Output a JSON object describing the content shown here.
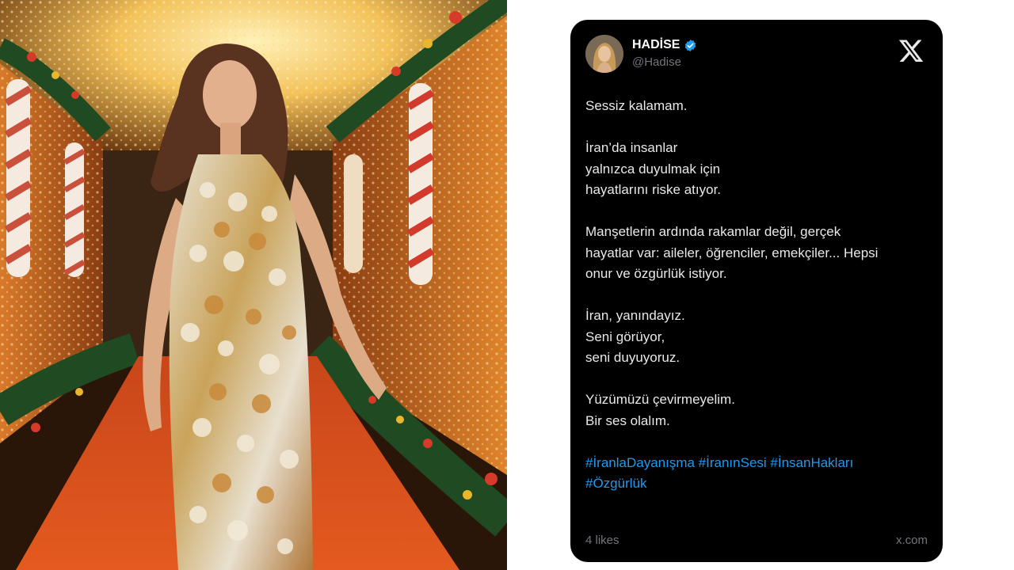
{
  "tweet": {
    "name": "HADİSE",
    "handle": "@Hadise",
    "paragraphs": [
      "Sessiz kalamam.",
      "İran’da insanlar\nyalnızca duyulmak için\nhayatlarını riske atıyor.",
      "Manşetlerin ardında rakamlar değil, gerçek\nhayatlar var: aileler, öğrenciler, emekçiler... Hepsi\nonur ve özgürlük istiyor.",
      "İran, yanındayız.\nSeni görüyor,\nseni duyuyoruz.",
      "Yüzümüzü çevirmeyelim.\nBir ses olalım."
    ],
    "hashtags": "#İranlaDayanışma #İranınSesi #İnsanHakları\n#Özgürlük",
    "likes": "4 likes",
    "source": "x.com"
  },
  "colors": {
    "card_bg": "#000000",
    "text": "#e7e9ea",
    "muted": "#71767b",
    "link": "#1d9bf0",
    "verified": "#1d9bf0",
    "carpet": "#e0561b",
    "lights": "#f7c65a"
  },
  "icons": {
    "verified": "verified-badge-icon",
    "logo": "x-logo-icon"
  }
}
